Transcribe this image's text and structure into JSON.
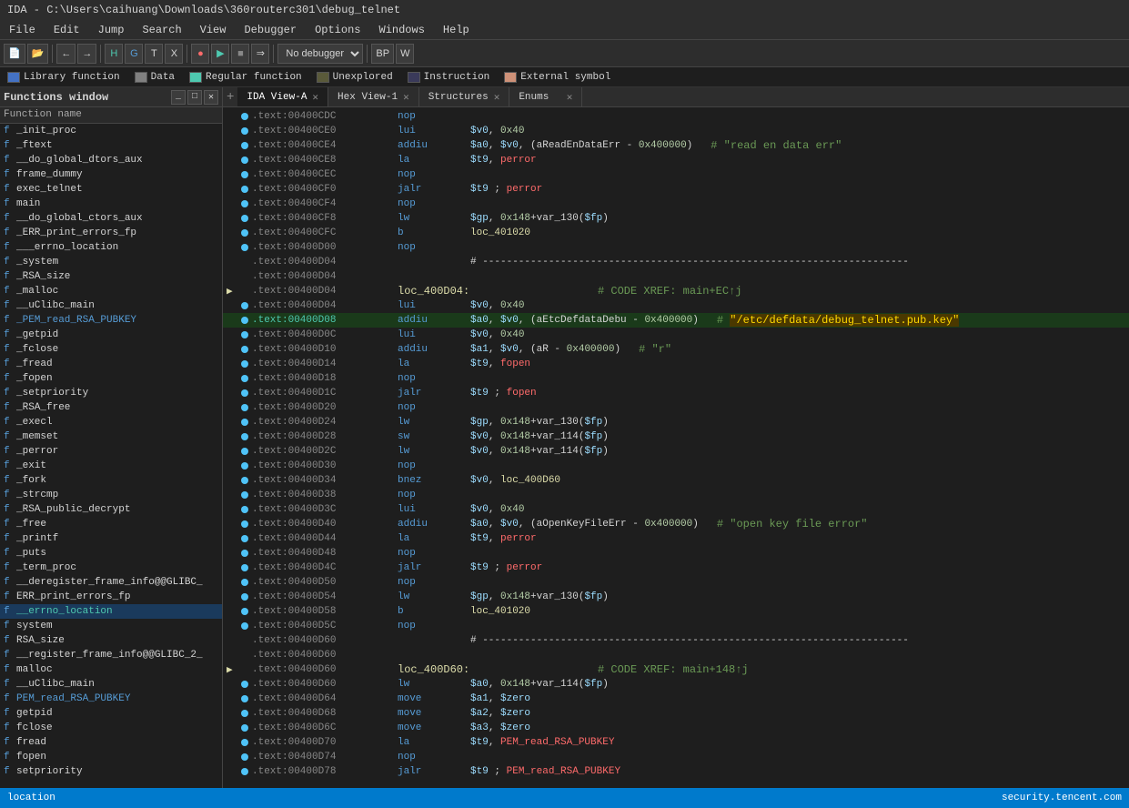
{
  "titleBar": {
    "text": "IDA - C:\\Users\\caihuang\\Downloads\\360routerc301\\debug_telnet"
  },
  "menuBar": {
    "items": [
      "File",
      "Edit",
      "Jump",
      "Search",
      "View",
      "Debugger",
      "Options",
      "Windows",
      "Help"
    ]
  },
  "legend": {
    "items": [
      {
        "label": "Library function",
        "color": "#569cd6"
      },
      {
        "label": "Data",
        "color": "#808080"
      },
      {
        "label": "Regular function",
        "color": "#4ec9b0"
      },
      {
        "label": "Unexplored",
        "color": "#666"
      },
      {
        "label": "Instruction",
        "color": "#1e1e1e"
      },
      {
        "label": "External symbol",
        "color": "#ce9178"
      }
    ]
  },
  "functionsPanel": {
    "title": "Functions window",
    "columnHeader": "Function name",
    "functions": [
      {
        "name": "_init_proc",
        "type": "f"
      },
      {
        "name": "_ftext",
        "type": "f"
      },
      {
        "name": "__do_global_dtors_aux",
        "type": "f"
      },
      {
        "name": "frame_dummy",
        "type": "f"
      },
      {
        "name": "exec_telnet",
        "type": "f"
      },
      {
        "name": "main",
        "type": "f"
      },
      {
        "name": "__do_global_ctors_aux",
        "type": "f"
      },
      {
        "name": "_ERR_print_errors_fp",
        "type": "f"
      },
      {
        "name": "___errno_location",
        "type": "f"
      },
      {
        "name": "_system",
        "type": "f"
      },
      {
        "name": "_RSA_size",
        "type": "f"
      },
      {
        "name": "_malloc",
        "type": "f"
      },
      {
        "name": "__uClibc_main",
        "type": "f"
      },
      {
        "name": "_PEM_read_RSA_PUBKEY",
        "type": "f",
        "color": "blue"
      },
      {
        "name": "_getpid",
        "type": "f"
      },
      {
        "name": "_fclose",
        "type": "f"
      },
      {
        "name": "_fread",
        "type": "f"
      },
      {
        "name": "_fopen",
        "type": "f"
      },
      {
        "name": "_setpriority",
        "type": "f"
      },
      {
        "name": "_RSA_free",
        "type": "f"
      },
      {
        "name": "_execl",
        "type": "f"
      },
      {
        "name": "_memset",
        "type": "f"
      },
      {
        "name": "_perror",
        "type": "f"
      },
      {
        "name": "_exit",
        "type": "f"
      },
      {
        "name": "_fork",
        "type": "f"
      },
      {
        "name": "_strcmp",
        "type": "f"
      },
      {
        "name": "_RSA_public_decrypt",
        "type": "f"
      },
      {
        "name": "_free",
        "type": "f"
      },
      {
        "name": "_printf",
        "type": "f"
      },
      {
        "name": "_puts",
        "type": "f"
      },
      {
        "name": "_term_proc",
        "type": "f"
      },
      {
        "name": "__deregister_frame_info@@GLIBC_",
        "type": "f"
      },
      {
        "name": "ERR_print_errors_fp",
        "type": "f"
      },
      {
        "name": "__errno_location",
        "type": "f",
        "color": "cyan"
      },
      {
        "name": "system",
        "type": "f"
      },
      {
        "name": "RSA_size",
        "type": "f"
      },
      {
        "name": "__register_frame_info@@GLIBC_2_",
        "type": "f"
      },
      {
        "name": "malloc",
        "type": "f"
      },
      {
        "name": "__uClibc_main",
        "type": "f"
      },
      {
        "name": "PEM_read_RSA_PUBKEY",
        "type": "f",
        "color": "blue"
      },
      {
        "name": "getpid",
        "type": "f"
      },
      {
        "name": "fclose",
        "type": "f"
      },
      {
        "name": "fread",
        "type": "f"
      },
      {
        "name": "fopen",
        "type": "f"
      },
      {
        "name": "setpriority",
        "type": "f"
      }
    ]
  },
  "tabs": [
    {
      "label": "IDA View-A",
      "active": true,
      "closeable": true
    },
    {
      "label": "Hex View-1",
      "active": false,
      "closeable": true
    },
    {
      "label": "Structures",
      "active": false,
      "closeable": true
    },
    {
      "label": "Enums",
      "active": false,
      "closeable": true
    }
  ],
  "disasmLines": [
    {
      "addr": ".text:00400CDC",
      "dot": true,
      "mnemonic": "nop",
      "operands": ""
    },
    {
      "addr": ".text:00400CE0",
      "dot": true,
      "mnemonic": "lui",
      "operands": "$v0, 0x40",
      "reg1": "$v0",
      "imm1": "0x40"
    },
    {
      "addr": ".text:00400CE4",
      "dot": true,
      "mnemonic": "addiu",
      "operands": "$a0, $v0, (aReadEnDataErr - 0x400000)",
      "comment": "# \"read en data err\""
    },
    {
      "addr": ".text:00400CE8",
      "dot": true,
      "mnemonic": "la",
      "operands": "$t9, perror"
    },
    {
      "addr": ".text:00400CEC",
      "dot": true,
      "mnemonic": "nop",
      "operands": ""
    },
    {
      "addr": ".text:00400CF0",
      "dot": true,
      "mnemonic": "jalr",
      "operands": "$t9 ; perror"
    },
    {
      "addr": ".text:00400CF4",
      "dot": true,
      "mnemonic": "nop",
      "operands": ""
    },
    {
      "addr": ".text:00400CF8",
      "dot": true,
      "mnemonic": "lw",
      "operands": "$gp, 0x148+var_130($fp)"
    },
    {
      "addr": ".text:00400CFC",
      "dot": true,
      "mnemonic": "b",
      "operands": "loc_401020"
    },
    {
      "addr": ".text:00400D00",
      "dot": true,
      "mnemonic": "nop",
      "operands": ""
    },
    {
      "addr": ".text:00400D04",
      "dot": false,
      "mnemonic": "",
      "operands": "# -----------------------------------------------------------------------"
    },
    {
      "addr": ".text:00400D04",
      "dot": false,
      "mnemonic": "",
      "operands": ""
    },
    {
      "addr": ".text:00400D04",
      "dot": false,
      "label": "loc_400D04:",
      "comment": "# CODE XREF: main+EC↑j"
    },
    {
      "addr": ".text:00400D04",
      "dot": true,
      "mnemonic": "lui",
      "operands": "$v0, 0x40"
    },
    {
      "addr": ".text:00400D08",
      "dot": true,
      "mnemonic": "addiu",
      "operands": "$a0, $v0, (aEtcDefdataDebu - 0x400000)",
      "comment": "# \"/etc/defdata/debug_telnet.pub.key\"",
      "highlighted": true
    },
    {
      "addr": ".text:00400D0C",
      "dot": true,
      "mnemonic": "lui",
      "operands": "$v0, 0x40"
    },
    {
      "addr": ".text:00400D10",
      "dot": true,
      "mnemonic": "addiu",
      "operands": "$a1, $v0, (aR - 0x400000)",
      "comment": "# \"r\""
    },
    {
      "addr": ".text:00400D14",
      "dot": true,
      "mnemonic": "la",
      "operands": "$t9, fopen"
    },
    {
      "addr": ".text:00400D18",
      "dot": true,
      "mnemonic": "nop",
      "operands": ""
    },
    {
      "addr": ".text:00400D1C",
      "dot": true,
      "mnemonic": "jalr",
      "operands": "$t9 ; fopen"
    },
    {
      "addr": ".text:00400D20",
      "dot": true,
      "mnemonic": "nop",
      "operands": ""
    },
    {
      "addr": ".text:00400D24",
      "dot": true,
      "mnemonic": "lw",
      "operands": "$gp, 0x148+var_130($fp)"
    },
    {
      "addr": ".text:00400D28",
      "dot": true,
      "mnemonic": "sw",
      "operands": "$v0, 0x148+var_114($fp)"
    },
    {
      "addr": ".text:00400D2C",
      "dot": true,
      "mnemonic": "lw",
      "operands": "$v0, 0x148+var_114($fp)"
    },
    {
      "addr": ".text:00400D30",
      "dot": true,
      "mnemonic": "nop",
      "operands": ""
    },
    {
      "addr": ".text:00400D34",
      "dot": true,
      "mnemonic": "bnez",
      "operands": "$v0, loc_400D60"
    },
    {
      "addr": ".text:00400D38",
      "dot": true,
      "mnemonic": "nop",
      "operands": ""
    },
    {
      "addr": ".text:00400D3C",
      "dot": true,
      "mnemonic": "lui",
      "operands": "$v0, 0x40"
    },
    {
      "addr": ".text:00400D40",
      "dot": true,
      "mnemonic": "addiu",
      "operands": "$a0, $v0, (aOpenKeyFileErr - 0x400000)",
      "comment": "# \"open key file error\""
    },
    {
      "addr": ".text:00400D44",
      "dot": true,
      "mnemonic": "la",
      "operands": "$t9, perror"
    },
    {
      "addr": ".text:00400D48",
      "dot": true,
      "mnemonic": "nop",
      "operands": ""
    },
    {
      "addr": ".text:00400D4C",
      "dot": true,
      "mnemonic": "jalr",
      "operands": "$t9 ; perror"
    },
    {
      "addr": ".text:00400D50",
      "dot": true,
      "mnemonic": "nop",
      "operands": ""
    },
    {
      "addr": ".text:00400D54",
      "dot": true,
      "mnemonic": "lw",
      "operands": "$gp, 0x148+var_130($fp)"
    },
    {
      "addr": ".text:00400D58",
      "dot": true,
      "mnemonic": "b",
      "operands": "loc_401020"
    },
    {
      "addr": ".text:00400D5C",
      "dot": true,
      "mnemonic": "nop",
      "operands": ""
    },
    {
      "addr": ".text:00400D60",
      "dot": false,
      "mnemonic": "",
      "operands": "# -----------------------------------------------------------------------"
    },
    {
      "addr": ".text:00400D60",
      "dot": false,
      "mnemonic": "",
      "operands": ""
    },
    {
      "addr": ".text:00400D60",
      "dot": false,
      "label": "loc_400D60:",
      "comment": "# CODE XREF: main+148↑j"
    },
    {
      "addr": ".text:00400D60",
      "dot": true,
      "mnemonic": "lw",
      "operands": "$a0, 0x148+var_114($fp)"
    },
    {
      "addr": ".text:00400D64",
      "dot": true,
      "mnemonic": "move",
      "operands": "$a1, $zero"
    },
    {
      "addr": ".text:00400D68",
      "dot": true,
      "mnemonic": "move",
      "operands": "$a2, $zero"
    },
    {
      "addr": ".text:00400D6C",
      "dot": true,
      "mnemonic": "move",
      "operands": "$a3, $zero"
    },
    {
      "addr": ".text:00400D70",
      "dot": true,
      "mnemonic": "la",
      "operands": "$t9, PEM_read_RSA_PUBKEY"
    },
    {
      "addr": ".text:00400D74",
      "dot": true,
      "mnemonic": "nop",
      "operands": ""
    },
    {
      "addr": ".text:00400D78",
      "dot": true,
      "mnemonic": "jalr",
      "operands": "$t9 ; PEM_read_RSA_PUBKEY"
    }
  ],
  "statusBar": {
    "left": "location",
    "right": "security.tencent.com"
  },
  "toolbar": {
    "debugger_select": "No debugger"
  }
}
